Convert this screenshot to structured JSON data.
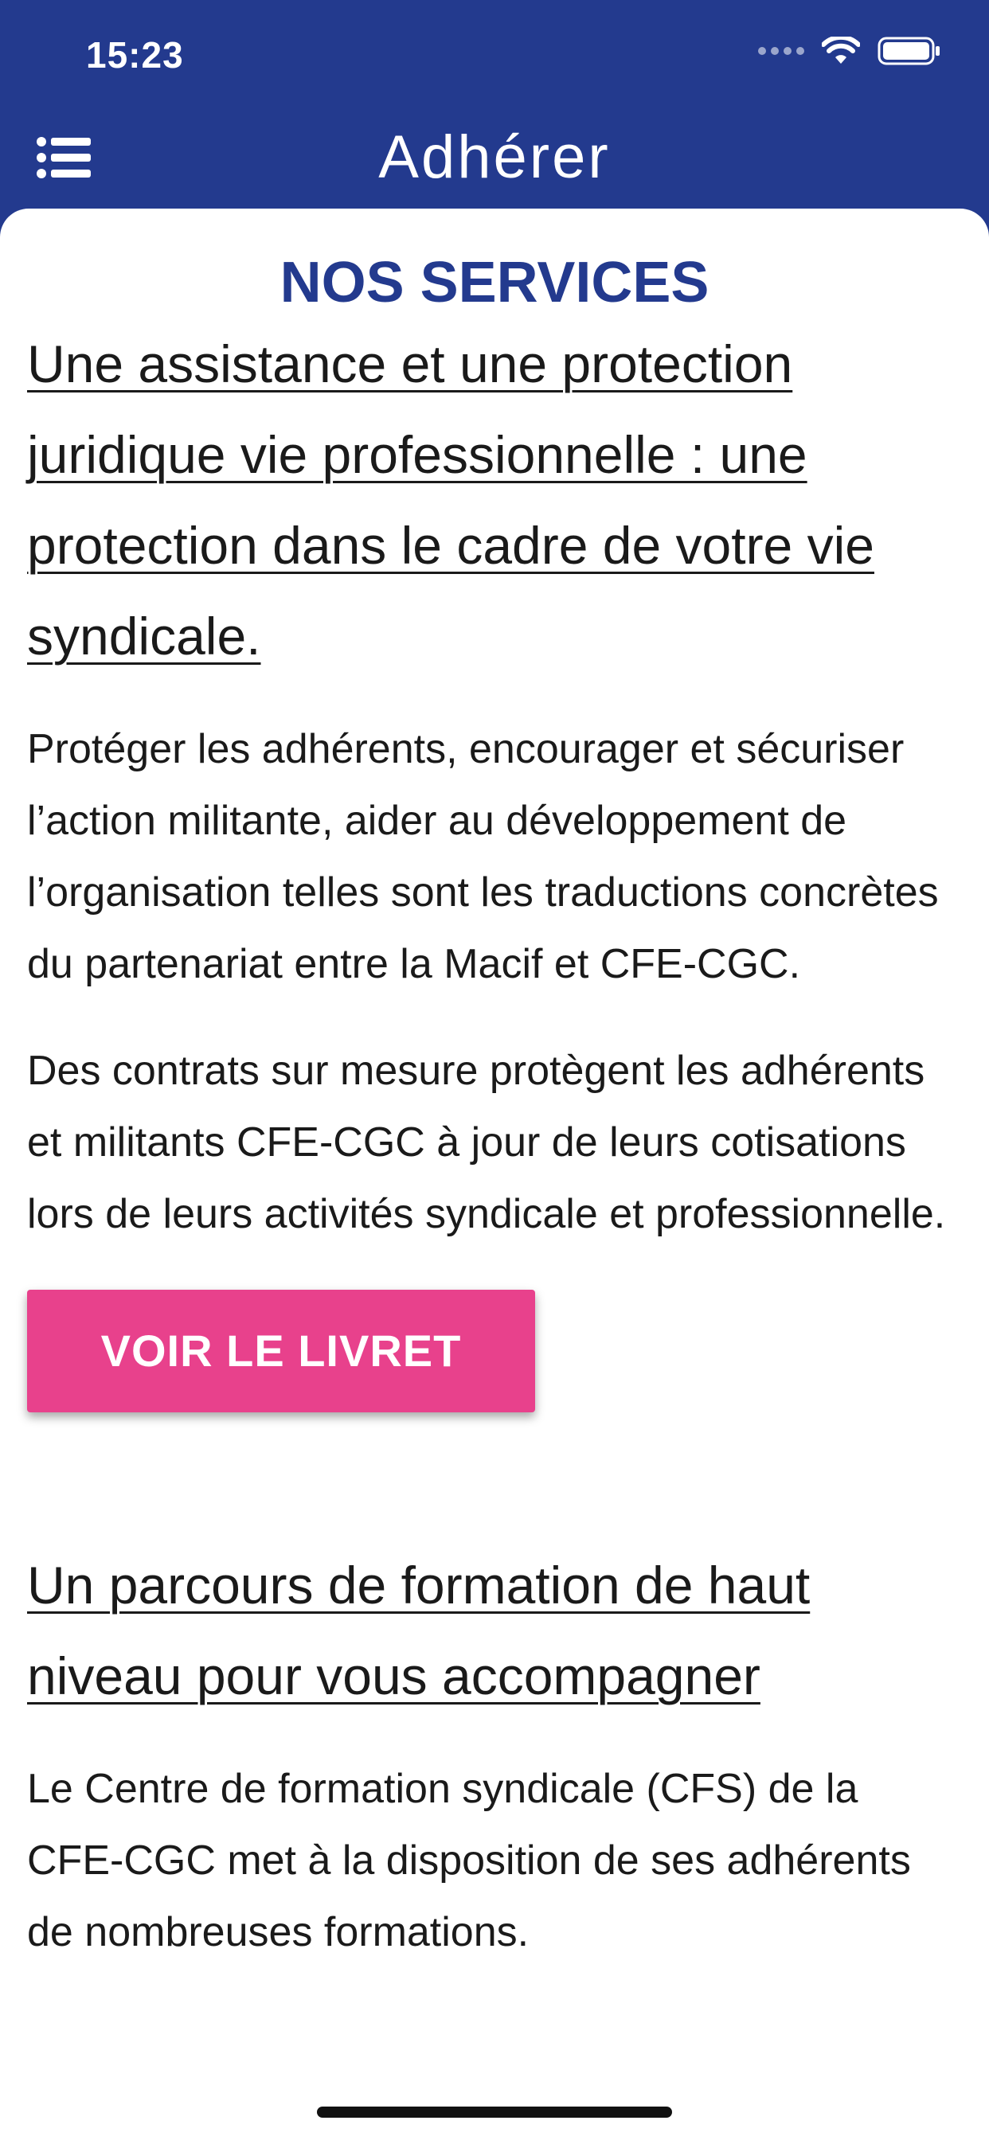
{
  "status_bar": {
    "time": "15:23"
  },
  "header": {
    "title": "Adhérer",
    "menu_icon": "hamburger-menu-icon"
  },
  "page": {
    "section_title": "NOS SERVICES",
    "services": [
      {
        "heading": "Une assistance et une  protection juridique vie professionnelle : une protection dans le cadre de votre vie syndicale.",
        "paragraphs": [
          "Protéger les adhérents, encourager et sécuriser l’action militante, aider au développement de l’organisation telles sont les traductions concrètes du partenariat entre la Macif et CFE-CGC.",
          "Des contrats sur mesure protègent les adhérents et militants CFE-CGC à jour de leurs cotisations lors de leurs activités syndicale et professionnelle."
        ],
        "button_label": "VOIR LE LIVRET"
      },
      {
        "heading": "Un parcours de formation de haut niveau pour vous accompagner",
        "paragraphs": [
          "Le Centre de formation syndicale (CFS) de la CFE-CGC met à la disposition de ses adhérents de nombreuses formations."
        ]
      }
    ]
  },
  "colors": {
    "header_bg": "#233a8e",
    "accent_button": "#e8418c",
    "section_title": "#233a8e"
  }
}
